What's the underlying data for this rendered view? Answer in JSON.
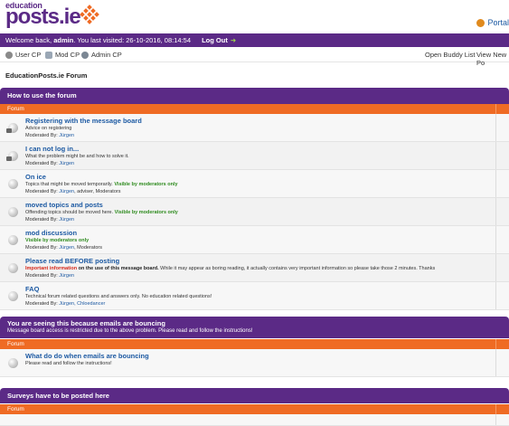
{
  "header": {
    "logo_small": "education",
    "logo_big": "posts.ie",
    "portal_label": "Portal"
  },
  "welcome": {
    "prefix": "Welcome back, ",
    "user": "admin",
    "last_visited": ". You last visited: 26-10-2016, 08:14:54",
    "logout": "Log Out"
  },
  "toolbar": {
    "user_cp": "User CP",
    "mod_cp": "Mod CP",
    "admin_cp": "Admin CP",
    "open_buddy": "Open Buddy List",
    "view_new": "View New Po"
  },
  "forum_title": "EducationPosts.ie Forum",
  "categories": [
    {
      "title": "How to use the forum",
      "column": "Forum",
      "rows": [
        {
          "title": "Registering with the message board",
          "desc": "Advice on registering",
          "mod_label": "Moderated By: ",
          "mods": "Jürgen",
          "mods_extra": ""
        },
        {
          "title": "I can not log in...",
          "desc": "What the problem might be and how to solve it.",
          "mod_label": "Moderated By: ",
          "mods": "Jürgen",
          "mods_extra": ""
        },
        {
          "title": "On ice",
          "desc": "Topics that might be moved temporarily. ",
          "desc_green": "Visible by moderators only",
          "mod_label": "Moderated By: ",
          "mods": "Jürgen",
          "mods_extra": ", adviser, Moderators"
        },
        {
          "title": "moved topics and posts",
          "desc": "Offending topics should be moved here. ",
          "desc_green": "Visible by moderators only",
          "mod_label": "Moderated By: ",
          "mods": "Jürgen",
          "mods_extra": ""
        },
        {
          "title": "mod discussion",
          "desc": "",
          "desc_green": "Visible by moderators only",
          "mod_label": "Moderated By: ",
          "mods": "Jürgen",
          "mods_extra": ", Moderators"
        },
        {
          "title": "Please read BEFORE posting",
          "desc_red": "Important information",
          "desc_bold": " on the use of this message board.",
          "desc": " While it may appear as boring reading, it actually contains very important information so please take those 2 minutes. Thanks",
          "mod_label": "Moderated By: ",
          "mods": "Jürgen",
          "mods_extra": ""
        },
        {
          "title": "FAQ",
          "desc": "Technical forum related questions and answers only. No education related questions!",
          "mod_label": "Moderated By: ",
          "mods": "Jürgen, Chloedancer",
          "mods_extra": ""
        }
      ]
    },
    {
      "title": "You are seeing this because emails are bouncing",
      "subtitle": "Message board access is restricted due to the above problem. Please read and follow the instructions!",
      "column": "Forum",
      "rows": [
        {
          "title": "What do do when emails are bouncing",
          "desc": "Please read and follow the instructions!"
        }
      ]
    },
    {
      "title": "Surveys have to be posted here",
      "column": "Forum"
    }
  ],
  "colors": {
    "purple": "#5b2a86",
    "orange": "#ef6b24",
    "link": "#1d5aa3"
  }
}
